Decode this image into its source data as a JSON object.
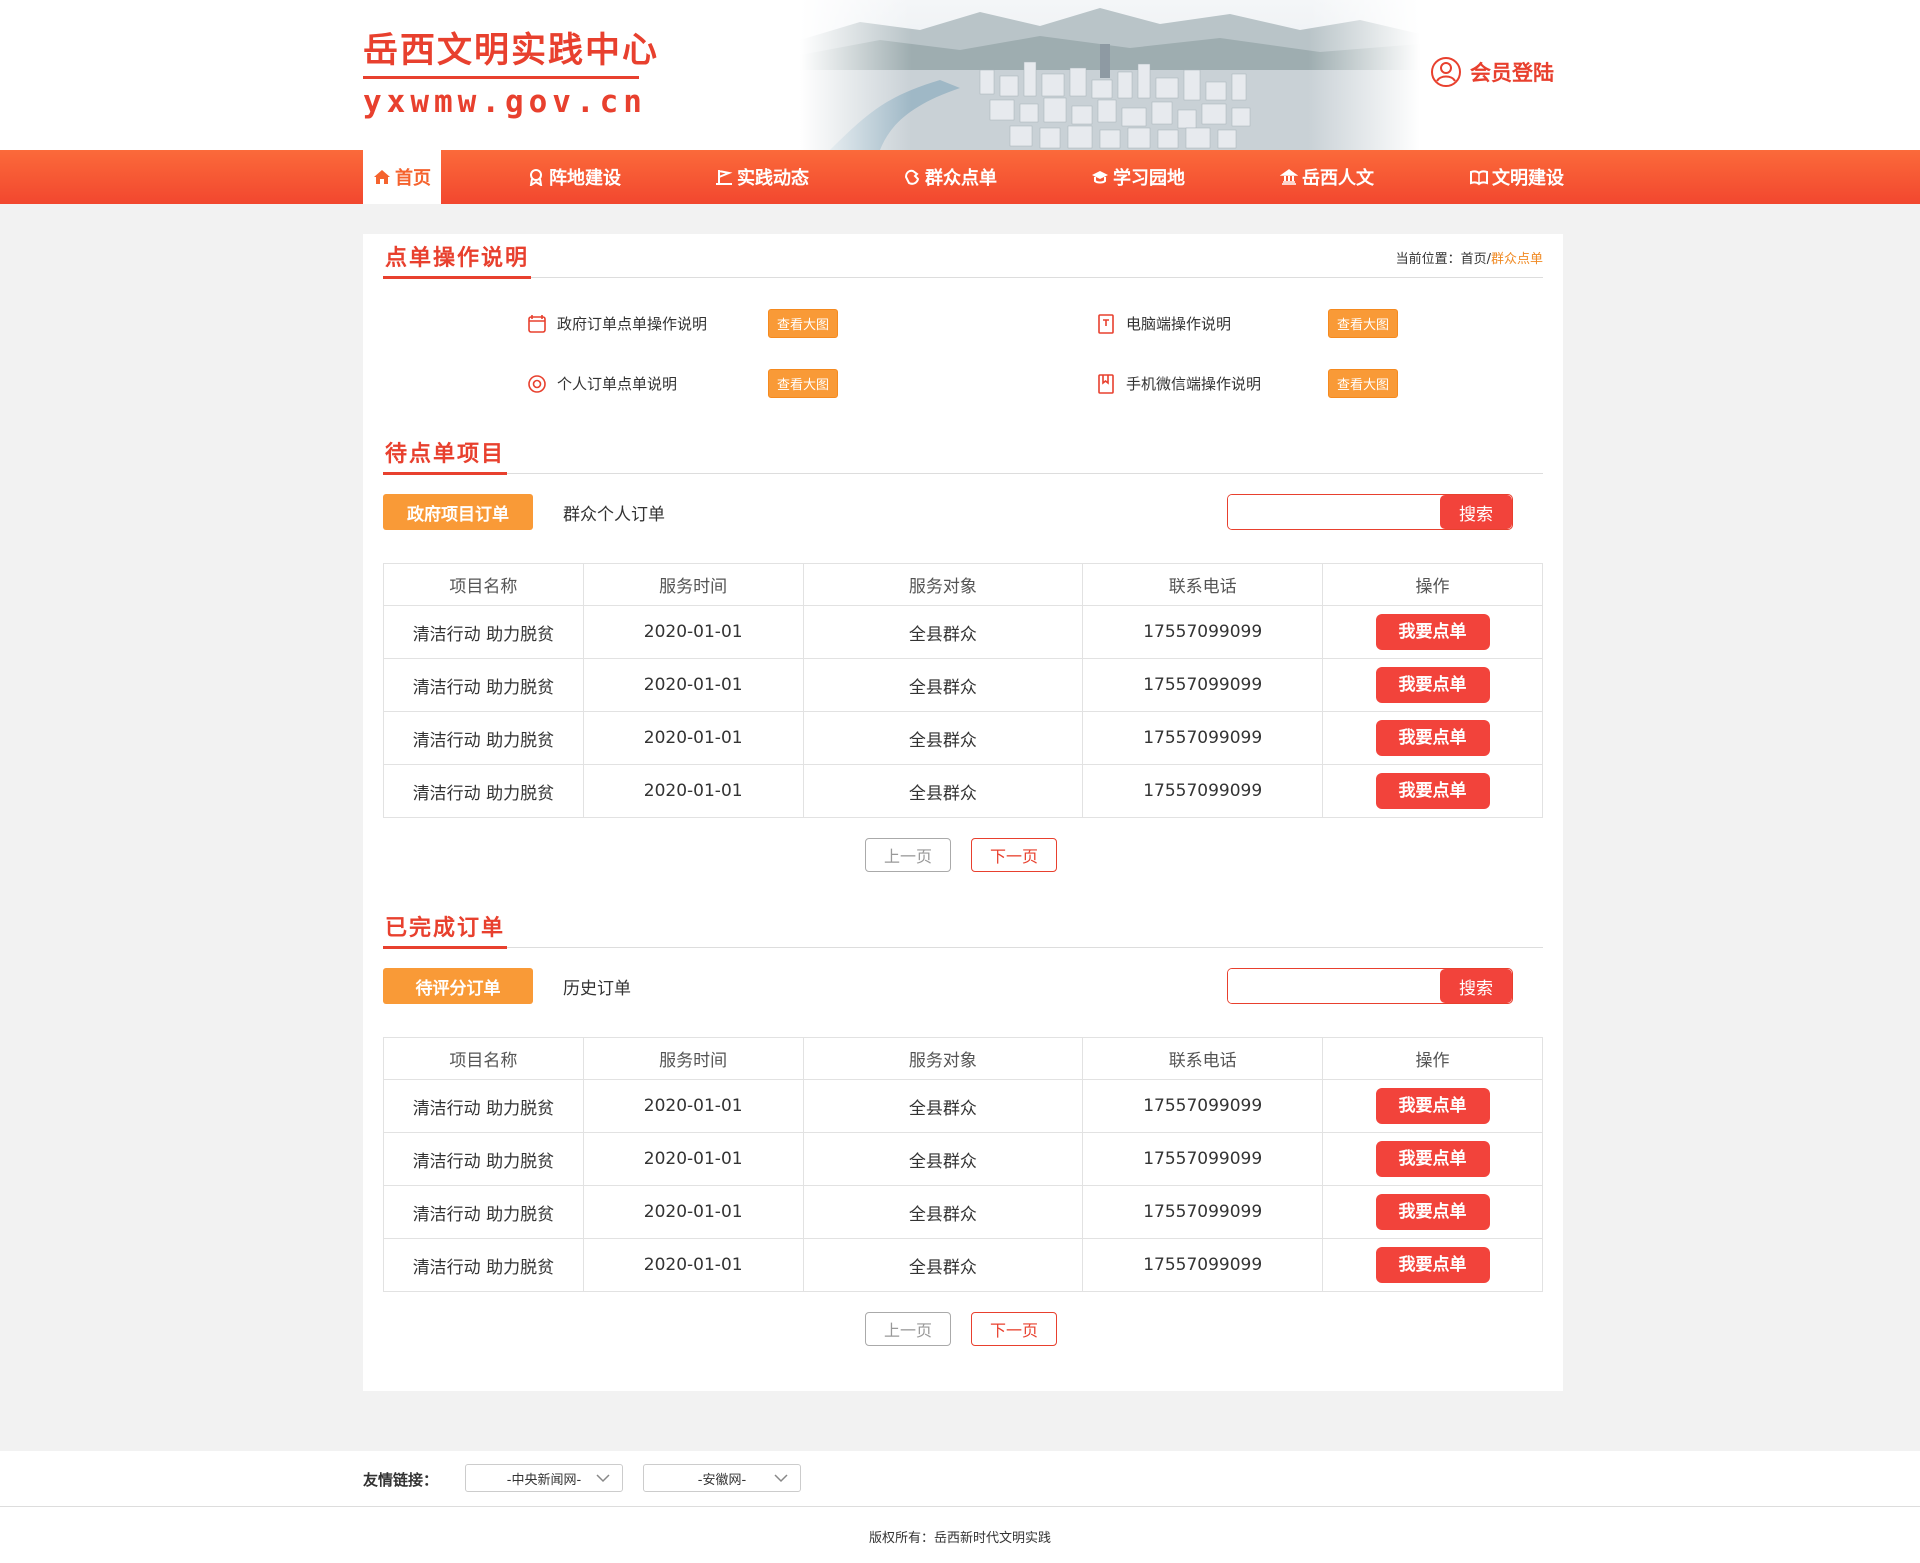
{
  "header": {
    "site_title": "岳西文明实践中心",
    "site_url": "yxwmw.gov.cn",
    "login_label": "会员登陆"
  },
  "nav": {
    "items": [
      {
        "label": "首页",
        "icon": "home-icon",
        "active": true
      },
      {
        "label": "阵地建设",
        "icon": "badge-icon"
      },
      {
        "label": "实践动态",
        "icon": "flag-icon"
      },
      {
        "label": "群众点单",
        "icon": "hand-icon"
      },
      {
        "label": "学习园地",
        "icon": "graduation-cap-icon"
      },
      {
        "label": "岳西人文",
        "icon": "building-icon"
      },
      {
        "label": "文明建设",
        "icon": "book-icon"
      }
    ]
  },
  "guide_section": {
    "title": "点单操作说明",
    "breadcrumb": {
      "prefix": "当前位置：",
      "home": "首页",
      "sep": "/",
      "current": "群众点单"
    },
    "items": [
      {
        "label": "政府订单点单操作说明",
        "icon": "calendar-icon",
        "button": "查看大图"
      },
      {
        "label": "电脑端操作说明",
        "icon": "document-icon",
        "button": "查看大图"
      },
      {
        "label": "个人订单点单说明",
        "icon": "target-icon",
        "button": "查看大图"
      },
      {
        "label": "手机微信端操作说明",
        "icon": "bookmark-icon",
        "button": "查看大图"
      }
    ]
  },
  "pending_section": {
    "title": "待点单项目",
    "tab_active": "政府项目订单",
    "tab_other": "群众个人订单",
    "search_placeholder": "",
    "search_button": "搜索",
    "columns": [
      "项目名称",
      "服务时间",
      "服务对象",
      "联系电话",
      "操作"
    ],
    "rows": [
      {
        "name": "清洁行动 助力脱贫",
        "time": "2020-01-01",
        "target": "全县群众",
        "phone": "17557099099",
        "action": "我要点单"
      },
      {
        "name": "清洁行动 助力脱贫",
        "time": "2020-01-01",
        "target": "全县群众",
        "phone": "17557099099",
        "action": "我要点单"
      },
      {
        "name": "清洁行动 助力脱贫",
        "time": "2020-01-01",
        "target": "全县群众",
        "phone": "17557099099",
        "action": "我要点单"
      },
      {
        "name": "清洁行动 助力脱贫",
        "time": "2020-01-01",
        "target": "全县群众",
        "phone": "17557099099",
        "action": "我要点单"
      }
    ],
    "prev_label": "上一页",
    "next_label": "下一页"
  },
  "done_section": {
    "title": "已完成订单",
    "tab_active": "待评分订单",
    "tab_other": "历史订单",
    "search_placeholder": "",
    "search_button": "搜索",
    "columns": [
      "项目名称",
      "服务时间",
      "服务对象",
      "联系电话",
      "操作"
    ],
    "rows": [
      {
        "name": "清洁行动 助力脱贫",
        "time": "2020-01-01",
        "target": "全县群众",
        "phone": "17557099099",
        "action": "我要点单"
      },
      {
        "name": "清洁行动 助力脱贫",
        "time": "2020-01-01",
        "target": "全县群众",
        "phone": "17557099099",
        "action": "我要点单"
      },
      {
        "name": "清洁行动 助力脱贫",
        "time": "2020-01-01",
        "target": "全县群众",
        "phone": "17557099099",
        "action": "我要点单"
      },
      {
        "name": "清洁行动 助力脱贫",
        "time": "2020-01-01",
        "target": "全县群众",
        "phone": "17557099099",
        "action": "我要点单"
      }
    ],
    "prev_label": "上一页",
    "next_label": "下一页"
  },
  "footer": {
    "friend_label": "友情链接：",
    "links": [
      "-中央新闻网-",
      "-安徽网-"
    ],
    "copyright": "版权所有：岳西新时代文明实践"
  },
  "colors": {
    "brand_red": "#e8402e",
    "nav_orange": "#f5582f",
    "accent_orange": "#f99a37",
    "button_red": "#f2433b"
  }
}
